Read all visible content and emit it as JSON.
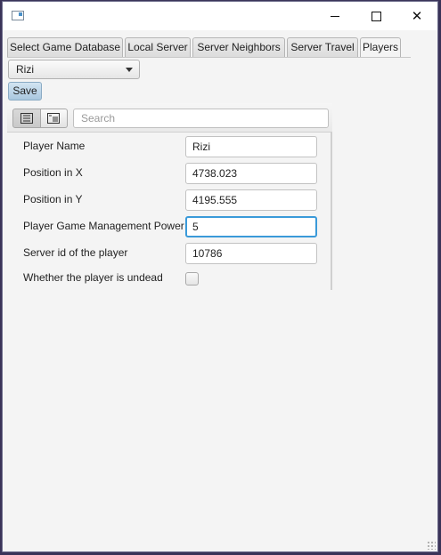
{
  "window": {
    "controls": {
      "minimize_icon": "minimize-icon",
      "maximize_icon": "maximize-icon",
      "close_icon": "close-icon"
    }
  },
  "tabs": [
    {
      "label": "Select Game Database",
      "active": false
    },
    {
      "label": "Local Server",
      "active": false
    },
    {
      "label": "Server Neighbors",
      "active": false
    },
    {
      "label": "Server Travel",
      "active": false
    },
    {
      "label": "Players",
      "active": true
    }
  ],
  "player_select": {
    "value": "Rizi"
  },
  "save_label": "Save",
  "property_sheet": {
    "search_placeholder": "Search",
    "rows": [
      {
        "label": "Player Name",
        "value": "Rizi"
      },
      {
        "label": "Position in X",
        "value": "4738.023"
      },
      {
        "label": "Position in Y",
        "value": "4195.555"
      },
      {
        "label": "Player Game Management Power",
        "value": "5"
      },
      {
        "label": "Server id of the player",
        "value": "10786"
      },
      {
        "label": "Whether the player is undead",
        "checked": false
      }
    ]
  },
  "colors": {
    "focus_ring": "#3a9ad9",
    "save_button": "#a9c7df",
    "desktop": "#3a3358"
  }
}
